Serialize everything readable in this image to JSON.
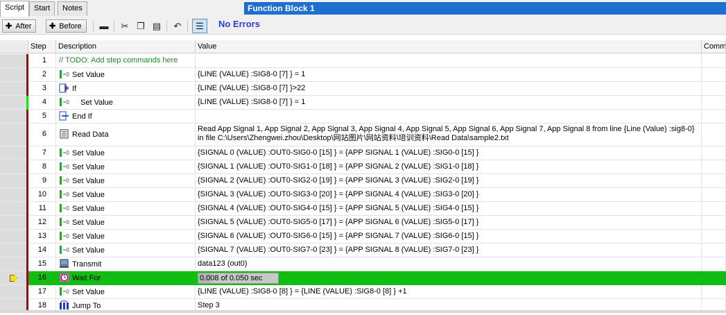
{
  "tabs": [
    "Script",
    "Start",
    "Notes"
  ],
  "block_title": "Function Block 1",
  "toolbar": {
    "after_label": "After",
    "before_label": "Before",
    "status": "No Errors"
  },
  "columns": {
    "step": "Step",
    "description": "Description",
    "value": "Value",
    "comment": "Comme"
  },
  "rows": [
    {
      "step": "1",
      "description": "// TODO: Add step commands here",
      "value": ""
    },
    {
      "step": "2",
      "description": "Set Value",
      "value": "{LINE (VALUE) :SIG8-0 [7] } = 1"
    },
    {
      "step": "3",
      "description": "If",
      "value": "{LINE (VALUE) :SIG8-0 [7] }>22"
    },
    {
      "step": "4",
      "description": "Set Value",
      "value": "{LINE (VALUE) :SIG8-0 [7] } = 1"
    },
    {
      "step": "5",
      "description": "End If",
      "value": ""
    },
    {
      "step": "6",
      "description": "Read Data",
      "value": "Read App Signal 1, App Signal 2, App Signal 3, App Signal 4, App Signal 5, App Signal 6, App Signal 7, App Signal 8 from line {Line (Value) :sig8-0} in file C:\\Users\\Zhengwei.zhou\\Desktop\\网站图片\\网站资料\\培训资料\\Read Data\\sample2.txt"
    },
    {
      "step": "7",
      "description": "Set Value",
      "value": "{SIGNAL 0 (VALUE) :OUT0-SIG0-0 [15] } = {APP SIGNAL 1 (VALUE) :SIG0-0 [15] }"
    },
    {
      "step": "8",
      "description": "Set Value",
      "value": "{SIGNAL 1 (VALUE) :OUT0-SIG1-0 [18] } = {APP SIGNAL 2 (VALUE) :SIG1-0 [18] }"
    },
    {
      "step": "9",
      "description": "Set Value",
      "value": "{SIGNAL 2 (VALUE) :OUT0-SIG2-0 [19] } = {APP SIGNAL 3 (VALUE) :SIG2-0 [19] }"
    },
    {
      "step": "10",
      "description": "Set Value",
      "value": "{SIGNAL 3 (VALUE) :OUT0-SIG3-0 [20] } = {APP SIGNAL 4 (VALUE) :SIG3-0 [20] }"
    },
    {
      "step": "11",
      "description": "Set Value",
      "value": "{SIGNAL 4 (VALUE) :OUT0-SIG4-0 [15] } = {APP SIGNAL 5 (VALUE) :SIG4-0 [15] }"
    },
    {
      "step": "12",
      "description": "Set Value",
      "value": "{SIGNAL 5 (VALUE) :OUT0-SIG5-0 [17] } = {APP SIGNAL 6 (VALUE) :SIG5-0 [17] }"
    },
    {
      "step": "13",
      "description": "Set Value",
      "value": "{SIGNAL 6 (VALUE) :OUT0-SIG6-0 [15] } = {APP SIGNAL 7 (VALUE) :SIG6-0 [15] }"
    },
    {
      "step": "14",
      "description": "Set Value",
      "value": "{SIGNAL 7 (VALUE) :OUT0-SIG7-0 [23] } = {APP SIGNAL 8 (VALUE) :SIG7-0 [23] }"
    },
    {
      "step": "15",
      "description": "Transmit",
      "value": "data123 (out0)"
    },
    {
      "step": "16",
      "description": "Wait For",
      "value": "0.008 of 0.050 sec",
      "progress": 0.16
    },
    {
      "step": "17",
      "description": "Set Value",
      "value": "{LINE (VALUE) :SIG8-0 [8] } = {LINE (VALUE) :SIG8-0 [8] } +1"
    },
    {
      "step": "18",
      "description": "Jump To",
      "value": "Step 3"
    }
  ]
}
